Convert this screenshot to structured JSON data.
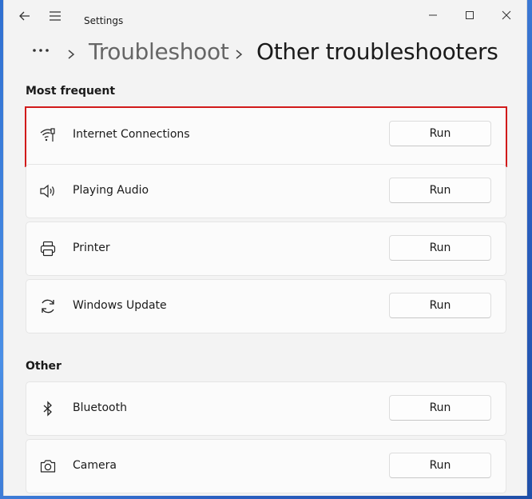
{
  "window": {
    "title": "Settings",
    "icons": {
      "back": "back-arrow-icon",
      "menu": "hamburger-menu-icon",
      "minimize": "minimize-icon",
      "maximize": "maximize-icon",
      "close": "close-icon"
    }
  },
  "breadcrumb": {
    "more_icon": "more-horizontal-icon",
    "parent": "Troubleshoot",
    "current": "Other troubleshooters"
  },
  "sections": {
    "most_frequent": {
      "title": "Most frequent",
      "items": [
        {
          "label": "Internet Connections",
          "icon": "wifi-icon",
          "button": "Run",
          "highlighted": true
        },
        {
          "label": "Playing Audio",
          "icon": "speaker-icon",
          "button": "Run"
        },
        {
          "label": "Printer",
          "icon": "printer-icon",
          "button": "Run"
        },
        {
          "label": "Windows Update",
          "icon": "refresh-icon",
          "button": "Run"
        }
      ]
    },
    "other": {
      "title": "Other",
      "items": [
        {
          "label": "Bluetooth",
          "icon": "bluetooth-icon",
          "button": "Run"
        },
        {
          "label": "Camera",
          "icon": "camera-icon",
          "button": "Run"
        }
      ]
    }
  },
  "colors": {
    "highlight_border": "#d11a1a",
    "window_bg": "#f3f3f3",
    "card_bg": "#fbfbfb"
  }
}
